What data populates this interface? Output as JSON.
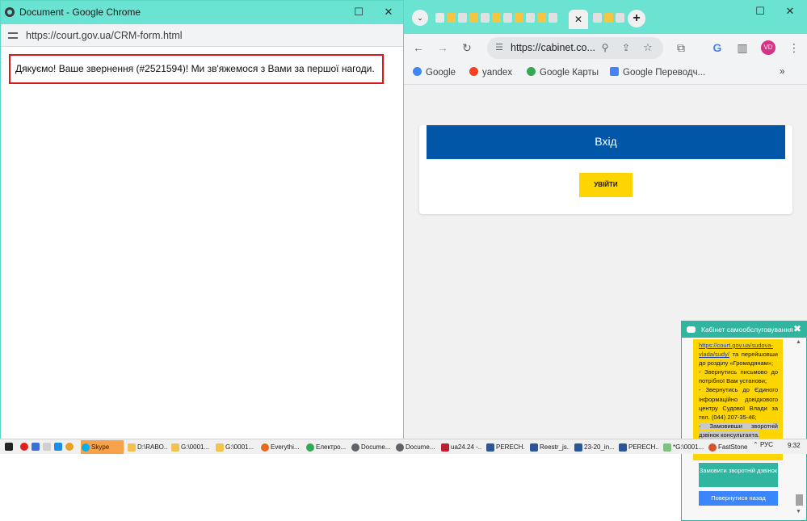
{
  "left_window": {
    "title": "Document - Google Chrome",
    "url": "https://court.gov.ua/CRM-form.html",
    "message": "Дякуємо! Ваше звернення (#2521594)! Ми зв'яжемося з Вами за першої нагоди."
  },
  "right_window": {
    "active_tab_close": "✕",
    "url": "https://cabinet.co...",
    "avatar": "VD",
    "bookmarks": [
      "Google",
      "yandex",
      "Google Карты",
      "Google Переводч..."
    ],
    "bookmarks_more": "»",
    "login": {
      "heading": "Вхід",
      "button": "УВІЙТИ"
    },
    "chat": {
      "title": "Кабінет самообслуговування",
      "link_text": "https://court.gov.ua/sudova-vlada/sudy/",
      "message_parts": [
        "та перейшовши до розділу «Громадянам»;",
        "- Звернутись письмово до потрібної Вам установи;",
        "- Звернутись до Єдиного інформаційно довідкового центру Судової Влади за тел. (044) 207-35-46;"
      ],
      "highlight": "- Замовивши зворотній дзвінок консультанта.",
      "callback_button": "Замовити зворотній дзвінок",
      "back_button": "Повернутися назад"
    }
  },
  "taskbar": {
    "items": [
      "Skype",
      "D:\\RABO...",
      "G:\\0001...",
      "G:\\0001...",
      "Everythi...",
      "Електро...",
      "Docume...",
      "Docume...",
      "ua24.24 -...",
      "PERECH...",
      "Reestr_js...",
      "23-20_in...",
      "PERECH...",
      "*G:\\0001...",
      "FastStone"
    ],
    "tray_lang": "РУС",
    "clock": "9:32"
  },
  "colors": {
    "title_bar": "#6be3d2",
    "accent_blue": "#0057a8",
    "accent_yellow": "#ffd500",
    "chat_teal": "#2fb5a0",
    "alert_red": "#d7191c"
  }
}
